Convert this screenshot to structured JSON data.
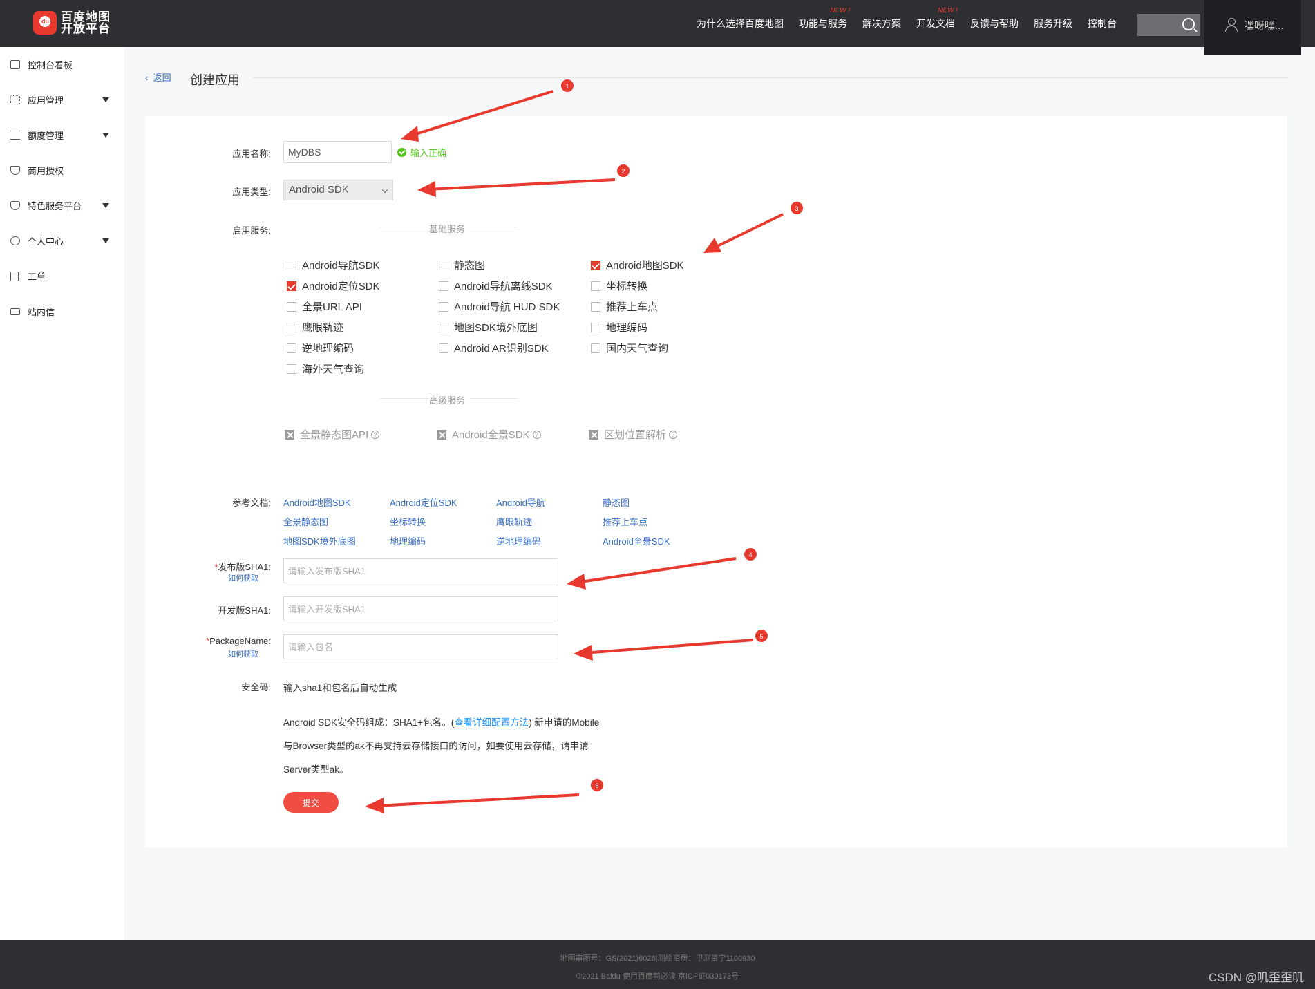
{
  "header": {
    "logo_line1": "百度地图",
    "logo_line2": "开放平台",
    "logo_badge": "du",
    "nav": [
      {
        "label": "为什么选择百度地图",
        "badge": ""
      },
      {
        "label": "功能与服务",
        "badge": "NEW !"
      },
      {
        "label": "解决方案",
        "badge": ""
      },
      {
        "label": "开发文档",
        "badge": "NEW !"
      },
      {
        "label": "反馈与帮助",
        "badge": ""
      },
      {
        "label": "服务升级",
        "badge": ""
      },
      {
        "label": "控制台",
        "badge": ""
      }
    ],
    "user_name": "嘿呀嘿..."
  },
  "sidebar": {
    "items": [
      {
        "label": "控制台看板",
        "icon": "dashboard-icon",
        "expandable": false
      },
      {
        "label": "应用管理",
        "icon": "grid-icon",
        "expandable": true
      },
      {
        "label": "额度管理",
        "icon": "sliders-icon",
        "expandable": true
      },
      {
        "label": "商用授权",
        "icon": "shield-icon",
        "expandable": false
      },
      {
        "label": "特色服务平台",
        "icon": "diamond-icon",
        "expandable": true
      },
      {
        "label": "个人中心",
        "icon": "user-circle-icon",
        "expandable": true
      },
      {
        "label": "工单",
        "icon": "clipboard-icon",
        "expandable": false
      },
      {
        "label": "站内信",
        "icon": "mail-icon",
        "expandable": false
      }
    ]
  },
  "breadcrumb": {
    "back": "返回",
    "title": "创建应用"
  },
  "form": {
    "app_name_label": "应用名称:",
    "app_name_value": "MyDBS",
    "app_name_ok": "输入正确",
    "app_type_label": "应用类型:",
    "app_type_value": "Android SDK",
    "services_label": "启用服务:",
    "basic_title": "基础服务",
    "basic_services": [
      {
        "label": "Android导航SDK",
        "checked": false
      },
      {
        "label": "静态图",
        "checked": false
      },
      {
        "label": "Android地图SDK",
        "checked": true
      },
      {
        "label": "Android定位SDK",
        "checked": true
      },
      {
        "label": "Android导航离线SDK",
        "checked": false
      },
      {
        "label": "坐标转换",
        "checked": false
      },
      {
        "label": "全景URL API",
        "checked": false
      },
      {
        "label": "Android导航 HUD SDK",
        "checked": false
      },
      {
        "label": "推荐上车点",
        "checked": false
      },
      {
        "label": "鹰眼轨迹",
        "checked": false
      },
      {
        "label": "地图SDK境外底图",
        "checked": false
      },
      {
        "label": "地理编码",
        "checked": false
      },
      {
        "label": "逆地理编码",
        "checked": false
      },
      {
        "label": "Android AR识别SDK",
        "checked": false
      },
      {
        "label": "国内天气查询",
        "checked": false
      },
      {
        "label": "海外天气查询",
        "checked": false
      }
    ],
    "advanced_title": "高级服务",
    "advanced_services": [
      {
        "label": "全景静态图API"
      },
      {
        "label": "Android全景SDK"
      },
      {
        "label": "区划位置解析"
      }
    ],
    "docs_label": "参考文档:",
    "docs": [
      "Android地图SDK",
      "Android定位SDK",
      "Android导航",
      "静态图",
      "全景静态图",
      "坐标转换",
      "鹰眼轨迹",
      "推荐上车点",
      "地图SDK境外底图",
      "地理编码",
      "逆地理编码",
      "Android全景SDK"
    ],
    "release_sha1_label": "发布版SHA1:",
    "release_sha1_placeholder": "请输入发布版SHA1",
    "how_to_get": "如何获取",
    "dev_sha1_label": "开发版SHA1:",
    "dev_sha1_placeholder": "请输入开发版SHA1",
    "package_label": "PackageName:",
    "package_placeholder": "请输入包名",
    "security_label": "安全码:",
    "security_value": "输入sha1和包名后自动生成",
    "note_line1_a": "Android SDK安全码组成：SHA1+包名。(",
    "note_link": "查看详细配置方法",
    "note_line1_b": ") 新申请的Mobile",
    "note_line2": "与Browser类型的ak不再支持云存储接口的访问，如要使用云存储，请申请",
    "note_line3": "Server类型ak。",
    "submit": "提交"
  },
  "footer": {
    "line1": "地图审图号：GS(2021)6026|测绘资质：甲测资字1100930",
    "line2": "©2021 Baidu 使用百度前必读 京ICP证030173号"
  },
  "watermark": "CSDN @叽歪歪叽",
  "annotations": [
    "1",
    "2",
    "3",
    "4",
    "5",
    "6"
  ],
  "colors": {
    "brand_red": "#e8392f",
    "topbar": "#2d2f33",
    "link": "#3a6fc4",
    "ok_green": "#52c41a"
  }
}
